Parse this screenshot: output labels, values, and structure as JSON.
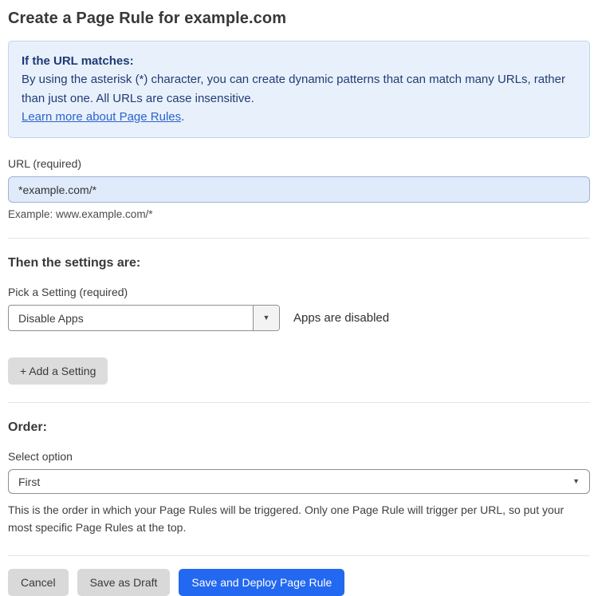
{
  "page": {
    "title": "Create a Page Rule for example.com"
  },
  "info_box": {
    "heading": "If the URL matches:",
    "body": "By using the asterisk (*) character, you can create dynamic patterns that can match many URLs, rather than just one. All URLs are case insensitive.",
    "link": "Learn more about Page Rules",
    "link_suffix": "."
  },
  "url_field": {
    "label": "URL (required)",
    "value": "*example.com/*",
    "helper": "Example: www.example.com/*"
  },
  "settings_section": {
    "heading": "Then the settings are:",
    "picker_label": "Pick a Setting (required)",
    "selected_setting": "Disable Apps",
    "status_text": "Apps are disabled",
    "add_setting_label": "+ Add a Setting"
  },
  "order_section": {
    "heading": "Order:",
    "select_label": "Select option",
    "selected_option": "First",
    "helper": "This is the order in which your Page Rules will be triggered. Only one Page Rule will trigger per URL, so put your most specific Page Rules at the top."
  },
  "actions": {
    "cancel": "Cancel",
    "save_draft": "Save as Draft",
    "save_deploy": "Save and Deploy Page Rule"
  },
  "icons": {
    "caret_down": "▼"
  },
  "colors": {
    "accent_blue": "#2368f0",
    "info_bg": "#e8f1fb",
    "info_border": "#bcd6f1",
    "info_text": "#223b77",
    "link_blue": "#2d62cc",
    "input_bg": "#dfeafa",
    "button_gray": "#d9d9d9"
  }
}
